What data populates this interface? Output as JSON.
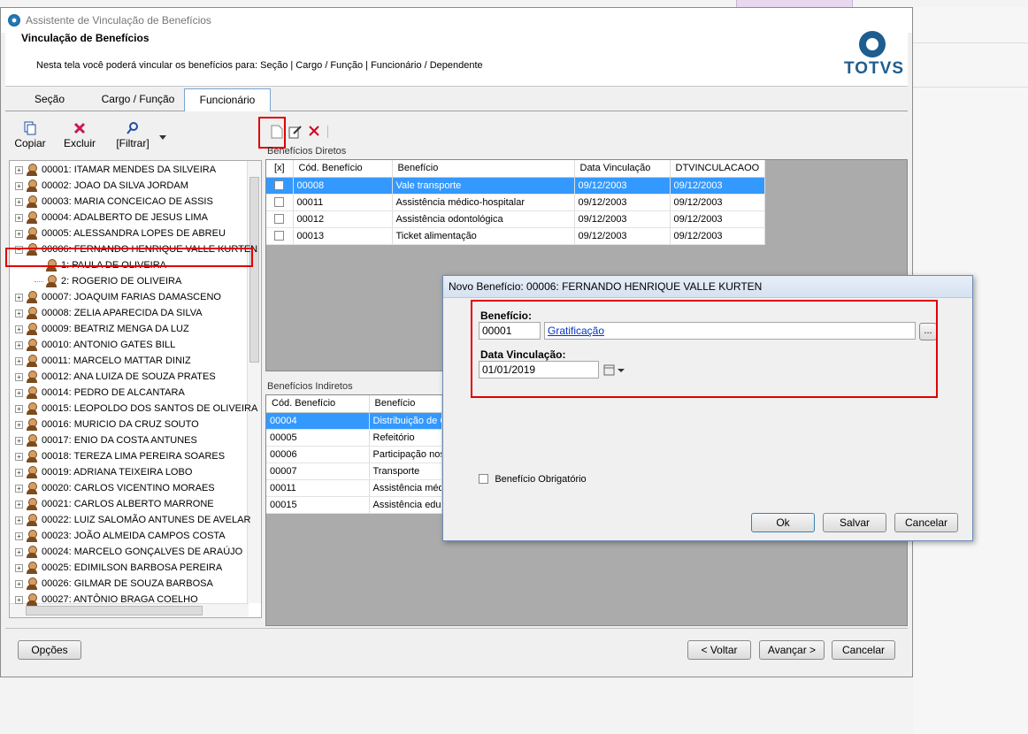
{
  "window": {
    "title": "Assistente de Vinculação de Benefícios"
  },
  "header": {
    "title": "Vinculação de Benefícios",
    "description": "Nesta tela você poderá vincular os benefícios para: Seção | Cargo / Função | Funcionário / Dependente",
    "logo_text": "TOTVS"
  },
  "tabs": [
    "Seção",
    "Cargo / Função",
    "Funcionário"
  ],
  "left_toolbar": {
    "copy": "Copiar",
    "delete": "Excluir",
    "filter": "[Filtrar]"
  },
  "tree": [
    "00001: ITAMAR MENDES DA SILVEIRA",
    "00002: JOAO DA SILVA JORDAM",
    "00003: MARIA CONCEICAO DE ASSIS",
    "00004: ADALBERTO DE JESUS LIMA",
    "00005: ALESSANDRA LOPES DE ABREU",
    "00006: FERNANDO HENRIQUE VALLE KURTEN",
    "1: PAULA DE OLIVEIRA",
    "2: ROGERIO DE OLIVEIRA",
    "00007: JOAQUIM FARIAS DAMASCENO",
    "00008: ZELIA APARECIDA DA SILVA",
    "00009: BEATRIZ MENGA DA LUZ",
    "00010: ANTONIO GATES BILL",
    "00011: MARCELO MATTAR DINIZ",
    "00012: ANA LUIZA  DE SOUZA PRATES",
    "00014: PEDRO DE ALCANTARA",
    "00015: LEOPOLDO DOS SANTOS DE OLIVEIRA",
    "00016: MURICIO DA CRUZ SOUTO",
    "00017: ENIO DA COSTA ANTUNES",
    "00018: TEREZA LIMA PEREIRA SOARES",
    "00019: ADRIANA TEIXEIRA LOBO",
    "00020: CARLOS VICENTINO MORAES",
    "00021: CARLOS ALBERTO MARRONE",
    "00022: LUIZ SALOMÃO ANTUNES DE AVELAR",
    "00023: JOÃO ALMEIDA CAMPOS COSTA",
    "00024: MARCELO GONÇALVES DE ARAÚJO",
    "00025: EDIMILSON BARBOSA PEREIRA",
    "00026: GILMAR DE SOUZA BARBOSA",
    "00027: ANTÔNIO BRAGA COELHO"
  ],
  "direct": {
    "label": "Benefícios Diretos",
    "headers": [
      "[x]",
      "Cód. Benefício",
      "Benefício",
      "Data Vinculação",
      "DTVINCULACAOO"
    ],
    "rows": [
      [
        "00008",
        "Vale transporte",
        "09/12/2003",
        "09/12/2003"
      ],
      [
        "00011",
        "Assistência médico-hospitalar",
        "09/12/2003",
        "09/12/2003"
      ],
      [
        "00012",
        "Assistência odontológica",
        "09/12/2003",
        "09/12/2003"
      ],
      [
        "00013",
        "Ticket alimentação",
        "09/12/2003",
        "09/12/2003"
      ]
    ]
  },
  "indirect": {
    "label": "Benefícios Indiretos",
    "headers": [
      "Cód. Benefício",
      "Benefício"
    ],
    "rows": [
      [
        "00004",
        "Distribuição de C"
      ],
      [
        "00005",
        "Refeitório"
      ],
      [
        "00006",
        "Participação nos"
      ],
      [
        "00007",
        "Transporte"
      ],
      [
        "00011",
        "Assistência médic"
      ],
      [
        "00015",
        "Assistência educ"
      ]
    ]
  },
  "dialog": {
    "title": "Novo Benefício: 00006: FERNANDO HENRIQUE VALLE KURTEN",
    "benefit_label": "Benefício",
    "benefit_code": "00001",
    "benefit_name": "Gratificação",
    "lookup": "...",
    "date_label": "Data Vinculação",
    "date_value": "01/01/2019",
    "mandatory_label": "Benefício Obrigatório",
    "ok": "Ok",
    "save": "Salvar",
    "cancel": "Cancelar"
  },
  "footer": {
    "options": "Opções",
    "back": "< Voltar",
    "next": "Avançar >",
    "cancel": "Cancelar"
  },
  "colors": {
    "selection": "#3399ff",
    "highlight": "#e00000",
    "brand": "#1d5d8f"
  }
}
